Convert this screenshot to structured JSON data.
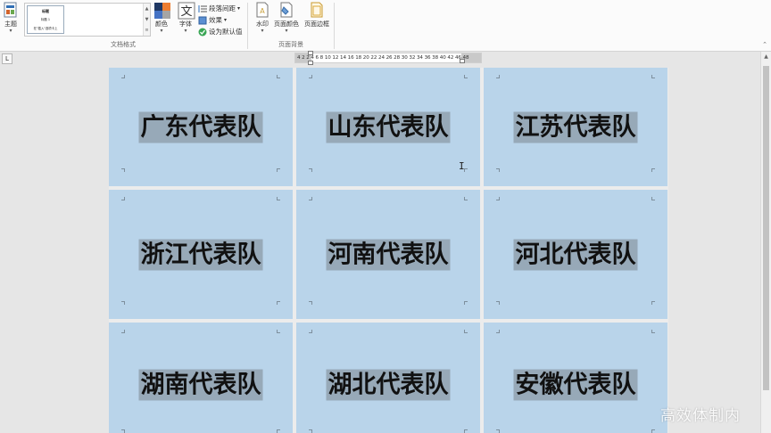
{
  "ribbon": {
    "theme_label": "主题",
    "gallery_thumb": {
      "title": "标题",
      "heading": "标题 1",
      "body": "在\"插入\"选项卡上"
    },
    "colors_label": "颜色",
    "fonts_label": "字体",
    "paragraph_spacing_label": "段落间距",
    "effects_label": "效果",
    "set_default_label": "设为默认值",
    "group_doc_format": "文档格式",
    "watermark_label": "水印",
    "page_color_label": "页面颜色",
    "page_borders_label": "页面边框",
    "group_page_background": "页面背景"
  },
  "ruler": {
    "tab_selector": "L",
    "numbers": "4  2     2   4   6   8  10 12 14 16 18 20 22 24 26 28 30 32 34 36 38 40 42      46 48"
  },
  "document": {
    "cards": [
      {
        "text": "广东代表队"
      },
      {
        "text": "山东代表队"
      },
      {
        "text": "江苏代表队"
      },
      {
        "text": "浙江代表队"
      },
      {
        "text": "河南代表队"
      },
      {
        "text": "河北代表队"
      },
      {
        "text": "湖南代表队"
      },
      {
        "text": "湖北代表队"
      },
      {
        "text": "安徽代表队"
      }
    ],
    "cursor": "I"
  },
  "watermark_text": "高效体制内",
  "colors": {
    "card_fill": "#b9d4ea",
    "text_highlight": "#97a9b8",
    "ribbon_bg": "#fbfbfb"
  }
}
